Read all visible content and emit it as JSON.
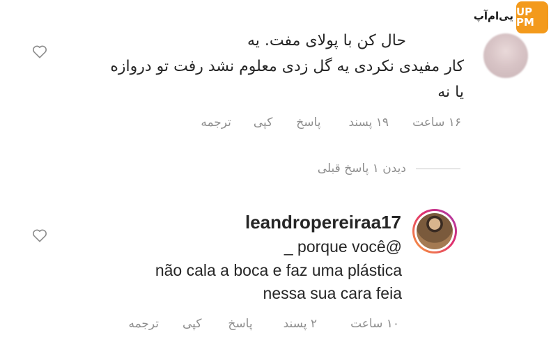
{
  "watermark": {
    "text": "یی‌ام‌آپ",
    "logo_text": "UP PM"
  },
  "comments": [
    {
      "lines": [
        "حال کن با پولای مفت. یه",
        "کار مفیدی نکردی یه گل زدی معلوم نشد رفت تو دروازه",
        "یا نه"
      ],
      "time": "۱۶ ساعت",
      "likes": "۱۹ پسند",
      "reply": "پاسخ",
      "copy": "کپی",
      "translate": "ترجمه"
    },
    {
      "username": "leandropereiraa17",
      "lines": [
        "_ porque você@",
        "não cala a boca e faz uma plástica",
        "nessa sua cara feia"
      ],
      "time": "۱۰ ساعت",
      "likes": "۲ پسند",
      "reply": "پاسخ",
      "copy": "کپی",
      "translate": "ترجمه"
    }
  ],
  "view_replies": "دیدن ۱ پاسخ قبلی"
}
